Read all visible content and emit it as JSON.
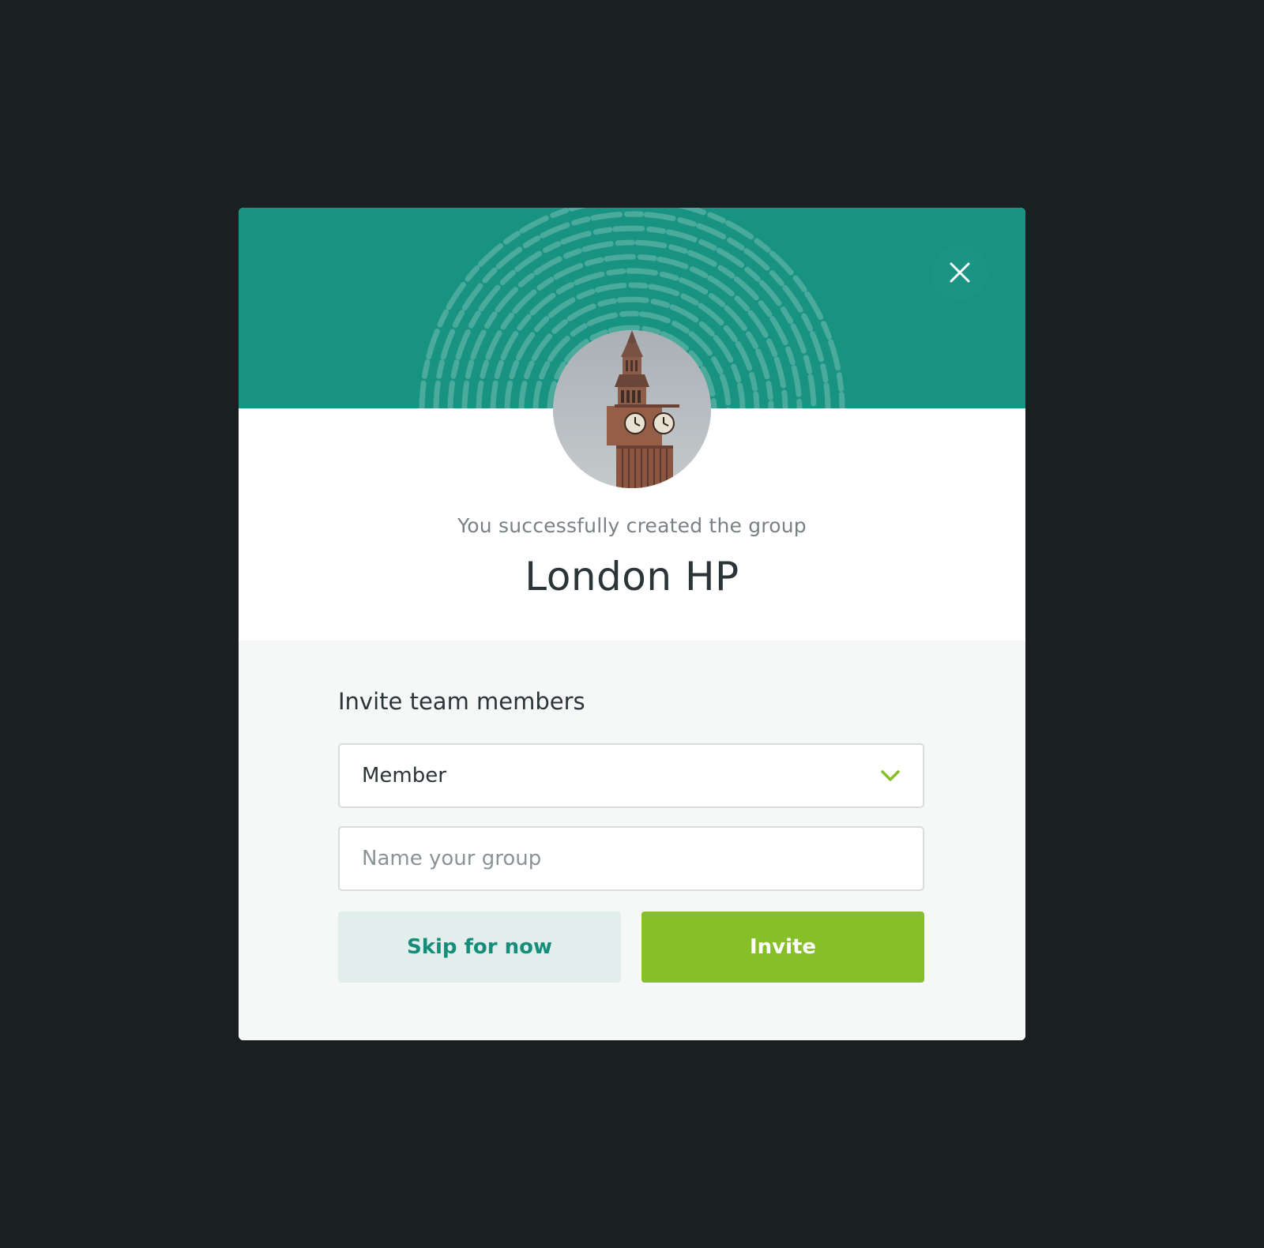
{
  "modal": {
    "success_message": "You successfully created the group",
    "group_name": "London HP",
    "header_color": "#189281",
    "accent_color": "#86bf28"
  },
  "invite": {
    "title": "Invite team members",
    "role_select": {
      "selected": "Member"
    },
    "group_input": {
      "value": "",
      "placeholder": "Name your group"
    },
    "skip_label": "Skip for now",
    "invite_label": "Invite"
  },
  "icons": {
    "close": "close-icon",
    "chevron": "chevron-down-icon",
    "avatar": "big-ben-tower-image",
    "pattern": "fingerprint-pattern"
  }
}
